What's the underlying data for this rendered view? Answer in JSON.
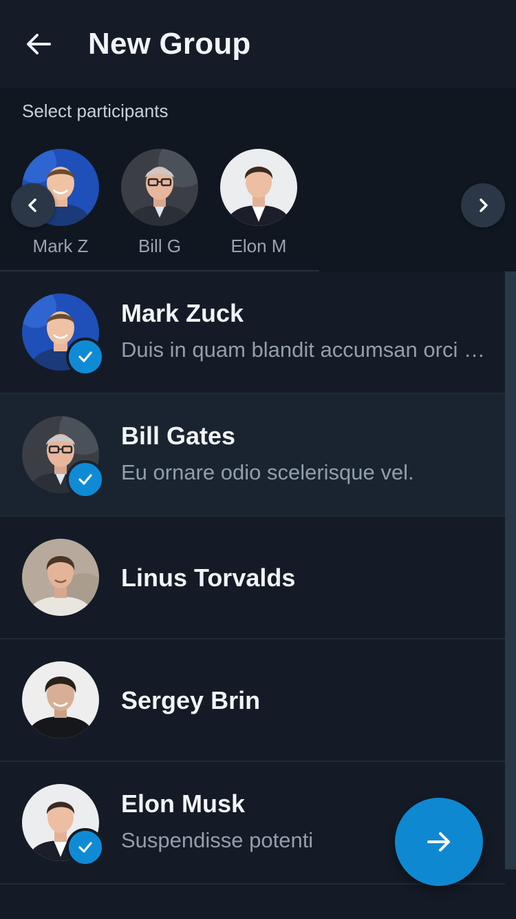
{
  "header": {
    "title": "New Group",
    "back_icon": "arrow-left-icon"
  },
  "selected": {
    "label": "Select participants",
    "chips": [
      {
        "name": "Mark Z"
      },
      {
        "name": "Bill G"
      },
      {
        "name": "Elon M"
      }
    ],
    "prev_icon": "chevron-left-icon",
    "next_icon": "chevron-right-icon"
  },
  "contacts": [
    {
      "name": "Mark Zuck",
      "status": "Duis in quam blandit accumsan orci eget",
      "selected": true
    },
    {
      "name": "Bill Gates",
      "status": "Eu ornare odio scelerisque vel.",
      "selected": true
    },
    {
      "name": "Linus Torvalds",
      "status": "",
      "selected": false
    },
    {
      "name": "Sergey Brin",
      "status": "",
      "selected": false
    },
    {
      "name": "Elon Musk",
      "status": "Suspendisse potenti",
      "selected": true
    }
  ],
  "fab": {
    "icon": "arrow-right-icon"
  },
  "colors": {
    "background": "#141b26",
    "accent": "#0f88d2",
    "highlight_row": "#1a2430"
  }
}
